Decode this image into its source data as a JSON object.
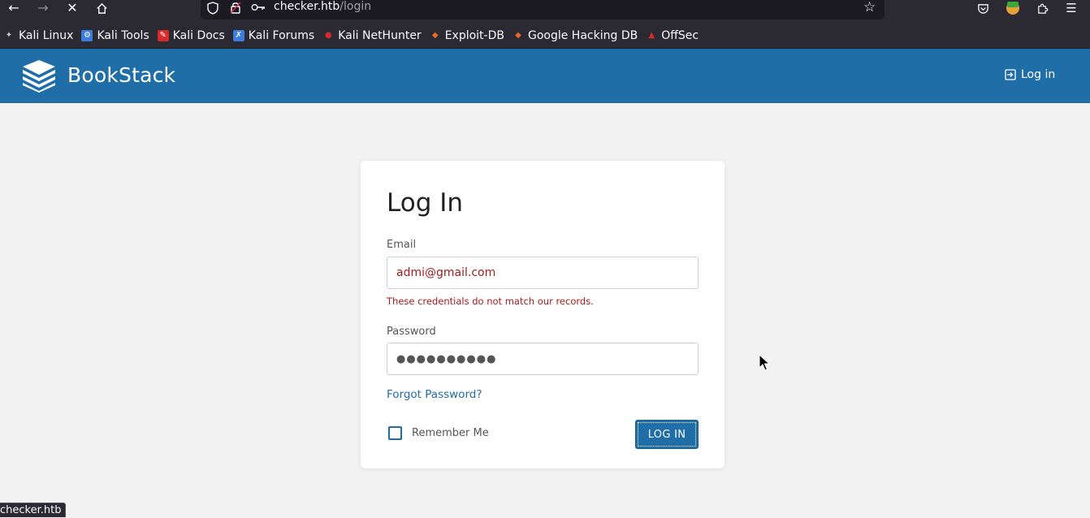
{
  "browser": {
    "url_host": "checker.htb",
    "url_path": "/login",
    "status_text": "checker.htb"
  },
  "bookmarks": [
    {
      "label": "Kali Linux",
      "icon": "kali-dragon-icon",
      "color": "#cccccc"
    },
    {
      "label": "Kali Tools",
      "icon": "kali-tools-icon",
      "color": "#3b7ddd"
    },
    {
      "label": "Kali Docs",
      "icon": "kali-docs-icon",
      "color": "#d62b2b"
    },
    {
      "label": "Kali Forums",
      "icon": "kali-forums-icon",
      "color": "#3b7ddd"
    },
    {
      "label": "Kali NetHunter",
      "icon": "nethunter-icon",
      "color": "#d62b2b"
    },
    {
      "label": "Exploit-DB",
      "icon": "exploitdb-icon",
      "color": "#e8692a"
    },
    {
      "label": "Google Hacking DB",
      "icon": "ghdb-icon",
      "color": "#e8692a"
    },
    {
      "label": "OffSec",
      "icon": "offsec-icon",
      "color": "#d62b2b"
    }
  ],
  "app": {
    "name": "BookStack",
    "header_login": "Log in",
    "accent": "#206ea7"
  },
  "login": {
    "title": "Log In",
    "email_label": "Email",
    "email_value": "admi@gmail.com",
    "error": "These credentials do not match our records.",
    "password_label": "Password",
    "password_masked": "●●●●●●●●●●",
    "forgot": "Forgot Password?",
    "remember": "Remember Me",
    "submit": "LOG IN"
  }
}
